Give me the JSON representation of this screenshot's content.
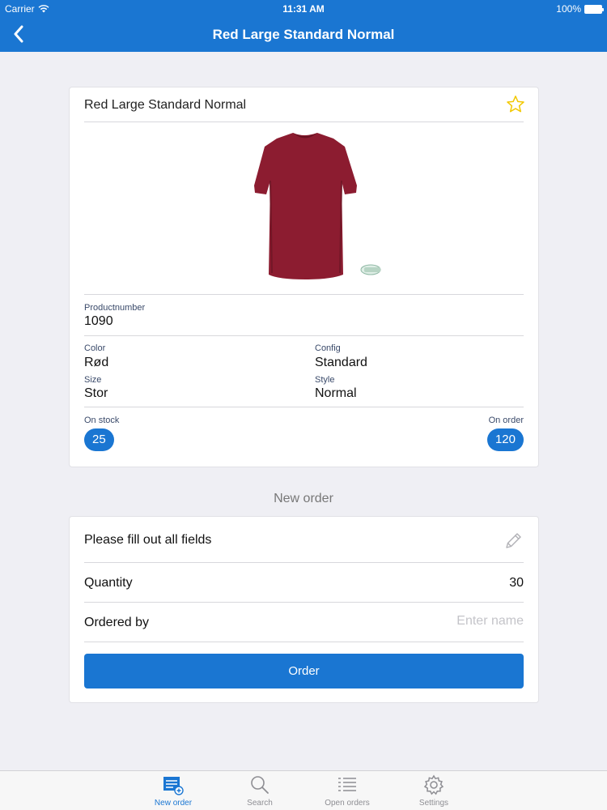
{
  "status_bar": {
    "carrier": "Carrier",
    "time": "11:31 AM",
    "battery": "100%"
  },
  "nav": {
    "title": "Red Large Standard Normal",
    "back_icon": "chevron-left-icon"
  },
  "product": {
    "title": "Red Large Standard Normal",
    "favorite_icon": "star-outline-icon",
    "image_subject": "t-shirt",
    "product_number_label": "Productnumber",
    "product_number": "1090",
    "color_label": "Color",
    "color": "Rød",
    "config_label": "Config",
    "config": "Standard",
    "size_label": "Size",
    "size": "Stor",
    "style_label": "Style",
    "style": "Normal",
    "on_stock_label": "On stock",
    "on_stock": "25",
    "on_order_label": "On order",
    "on_order": "120"
  },
  "new_order": {
    "section_title": "New order",
    "instructions": "Please fill out all fields",
    "edit_icon": "pencil-icon",
    "quantity_label": "Quantity",
    "quantity": "30",
    "ordered_by_label": "Ordered by",
    "ordered_by_value": "",
    "ordered_by_placeholder": "Enter name",
    "order_button": "Order"
  },
  "tabs": [
    {
      "label": "New order",
      "icon": "new-order-icon",
      "active": true
    },
    {
      "label": "Search",
      "icon": "search-icon",
      "active": false
    },
    {
      "label": "Open orders",
      "icon": "list-icon",
      "active": false
    },
    {
      "label": "Settings",
      "icon": "gear-icon",
      "active": false
    }
  ],
  "colors": {
    "accent": "#1a76d2",
    "background": "#efeff4",
    "star": "#f2c800",
    "shirt": "#8c1c30"
  }
}
